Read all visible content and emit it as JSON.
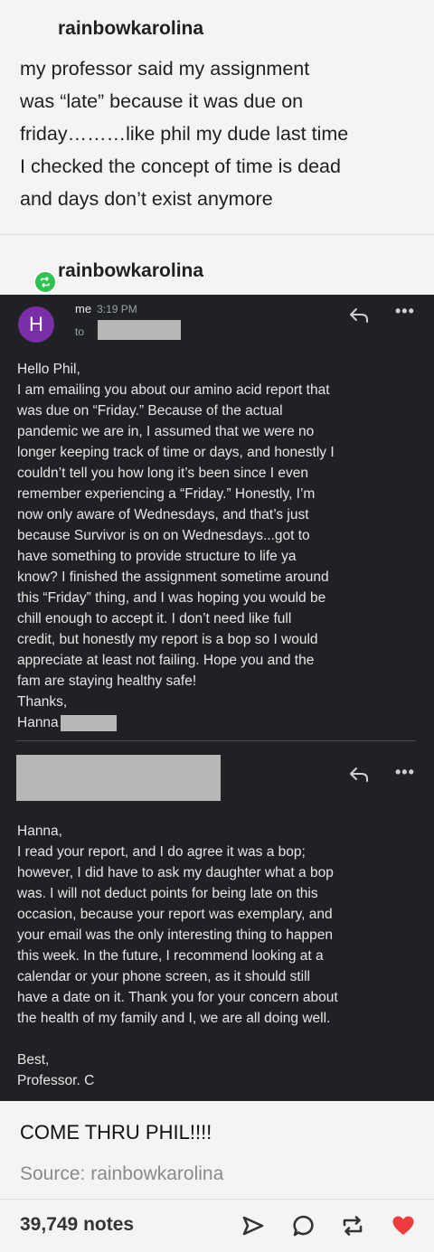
{
  "post": {
    "username": "rainbowkarolina",
    "text_lines": [
      "my professor said my assignment",
      "was “late” because it was due on",
      "friday………like phil my dude last time",
      "I checked the concept of time is dead",
      "and days don’t exist anymore"
    ]
  },
  "reblog": {
    "username": "rainbowkarolina"
  },
  "email1": {
    "avatar_letter": "H",
    "sender": "me",
    "time": "3:19 PM",
    "to_label": "to",
    "body_lines": [
      "Hello Phil,",
      "I am emailing you about our amino acid report that",
      "was due on “Friday.” Because of the actual",
      "pandemic we are in, I assumed that we were no",
      "longer keeping track of time or days, and honestly I",
      "couldn’t tell you how long it’s been since I even",
      "remember experiencing a “Friday.” Honestly, I’m",
      "now only aware of Wednesdays, and that’s just",
      "because Survivor is on on Wednesdays...got to",
      "have something to provide structure to life ya",
      "know? I finished the assignment sometime around",
      "this “Friday” thing, and I was hoping you would be",
      "chill enough to accept it. I don’t need like full",
      "credit, but honestly my report is a bop so I would",
      "appreciate at least not failing. Hope you and the",
      "fam are staying healthy safe!",
      "Thanks,",
      "Hanna"
    ]
  },
  "email2": {
    "body_lines": [
      "Hanna,",
      "I read your report, and I do agree it was a bop;",
      "however, I did have to ask my daughter what a bop",
      "was. I will not deduct points for being late on this",
      "occasion, because your report was exemplary, and",
      "your email was the only interesting thing to happen",
      "this week. In the future, I recommend looking at a",
      "calendar or your phone screen, as it should still",
      "have a date on it. Thank you for your concern about",
      "the health of my family and I, we are all doing well."
    ],
    "signoff_lines": [
      "Best,",
      "Professor. C"
    ]
  },
  "footer": {
    "comment": "COME THRU PHIL!!!!",
    "source": "Source: rainbowkarolina",
    "notes": "39,749 notes"
  },
  "icons": {
    "share": "share-icon",
    "comment": "comment-icon",
    "reblog": "reblog-icon",
    "like": "heart-icon"
  },
  "colors": {
    "like": "#ee3b3b",
    "reblog_badge": "#2ec24e",
    "avatar": "#7a2fa8",
    "email_bg": "#202124"
  }
}
